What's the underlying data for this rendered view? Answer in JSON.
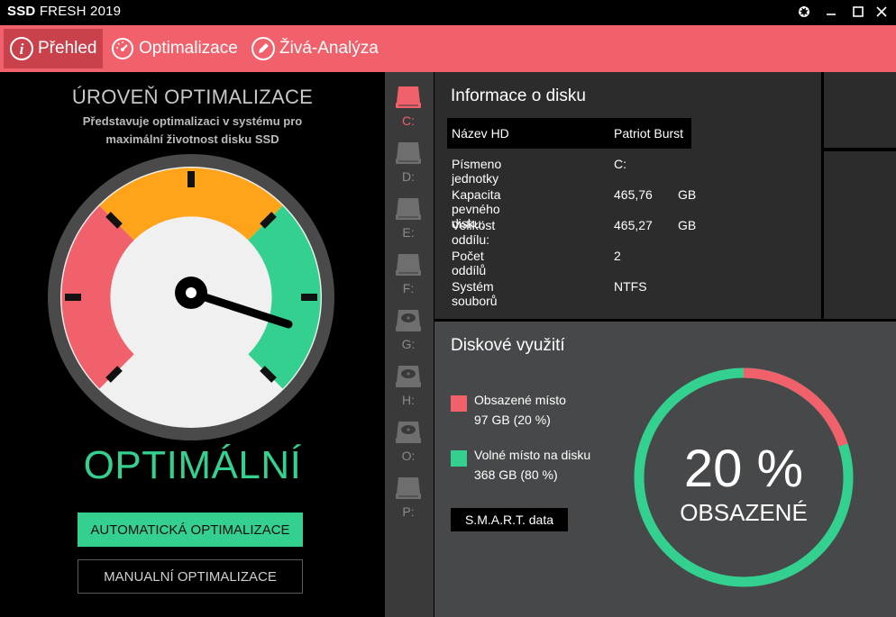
{
  "window": {
    "title_bold": "SSD",
    "title_rest": " FRESH 2019",
    "controls": [
      "gear-icon",
      "minimize-icon",
      "maximize-icon",
      "close-icon"
    ]
  },
  "tabs": [
    {
      "label": "Přehled",
      "icon": "info-icon",
      "active": true
    },
    {
      "label": "Optimalizace",
      "icon": "speedometer-icon",
      "active": false
    },
    {
      "label": "Živá-Analýza",
      "icon": "pen-icon",
      "active": false
    }
  ],
  "optimization": {
    "title": "ÚROVEŇ OPTIMALIZACE",
    "subtitle_line1": "Představuje optimalizaci v systému pro",
    "subtitle_line2": "maximální životnost disku SSD",
    "status": "OPTIMÁLNÍ",
    "auto_button": "AUTOMATICKÁ OPTIMALIZACE",
    "manual_button": "MANUALNÍ OPTIMALIZACE"
  },
  "drives": [
    {
      "label": "C:",
      "active": true,
      "type": "ssd"
    },
    {
      "label": "D:",
      "active": false,
      "type": "ssd"
    },
    {
      "label": "E:",
      "active": false,
      "type": "ssd"
    },
    {
      "label": "F:",
      "active": false,
      "type": "ssd"
    },
    {
      "label": "G:",
      "active": false,
      "type": "hdd"
    },
    {
      "label": "H:",
      "active": false,
      "type": "hdd"
    },
    {
      "label": "O:",
      "active": false,
      "type": "hdd"
    },
    {
      "label": "P:",
      "active": false,
      "type": "ssd"
    }
  ],
  "disk_info": {
    "title": "Informace o disku",
    "rows": [
      {
        "key": "Název HD",
        "value": "Patriot Burst",
        "unit": ""
      },
      {
        "key": "Písmeno jednotky",
        "value": "C:",
        "unit": ""
      },
      {
        "key": "Kapacita pevného disku:",
        "value": "465,76",
        "unit": "GB"
      },
      {
        "key": "Velikost oddílu:",
        "value": "465,27",
        "unit": "GB"
      },
      {
        "key": "Počet oddílů",
        "value": "2",
        "unit": ""
      },
      {
        "key": "Systém souborů",
        "value": "NTFS",
        "unit": ""
      }
    ]
  },
  "usage": {
    "title": "Diskové využití",
    "used_label": "Obsazené místo",
    "used_value": "97 GB (20 %)",
    "free_label": "Volné místo na disku",
    "free_value": "368 GB (80 %)",
    "smart_button": "S.M.A.R.T. data",
    "percent_text": "20 %",
    "percent_label": "OBSAZENÉ",
    "used_fraction": 0.2
  },
  "colors": {
    "accent_red": "#f1616b",
    "accent_green": "#34d08f",
    "accent_orange": "#ffa31a"
  }
}
